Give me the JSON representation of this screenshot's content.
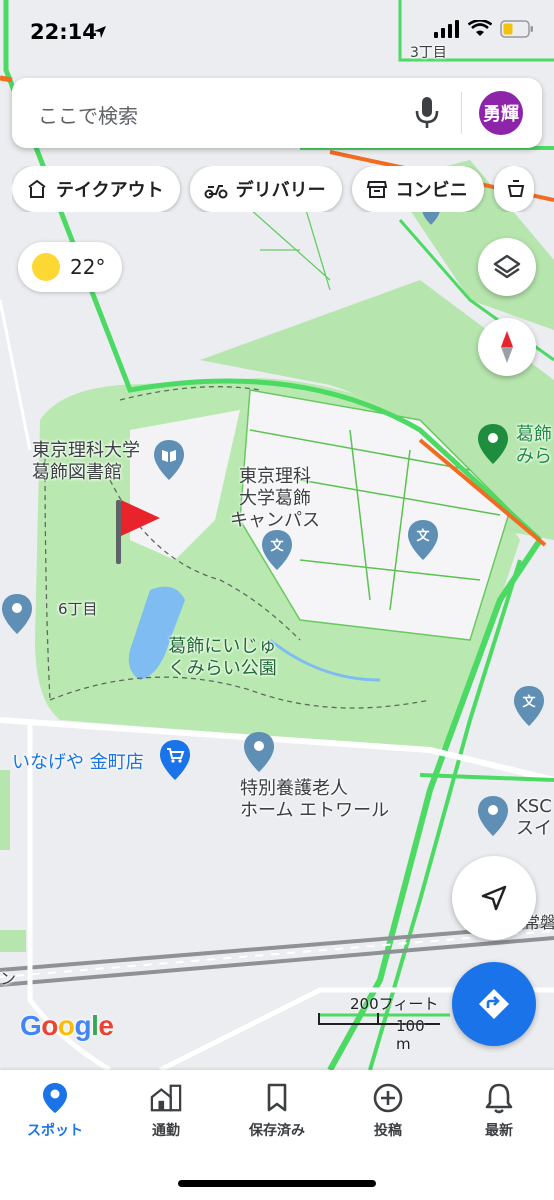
{
  "status_bar": {
    "time": "22:14"
  },
  "search": {
    "placeholder": "ここで検索",
    "avatar_text": "勇輝"
  },
  "chips": [
    {
      "label": "テイクアウト",
      "icon": "takeout-icon"
    },
    {
      "label": "デリバリー",
      "icon": "delivery-scooter-icon"
    },
    {
      "label": "コンビニ",
      "icon": "store-icon"
    }
  ],
  "weather": {
    "temperature": "22°",
    "icon": "sun-icon"
  },
  "map_labels": {
    "district_3": "3丁目",
    "library": "東京理科大学\n葛飾図書館",
    "campus": "東京理科\n大学葛飾\nキャンパス",
    "district_6": "6丁目",
    "park": "葛飾にいじゅ\nくみらい公園",
    "inageya": "いなげや 金町店",
    "nursing_home": "特別養護老人\nホーム エトワール",
    "ksc": "KSC\nスイ",
    "katsushika_right": "葛飾\nみら",
    "joban": "常磐",
    "left_edge": "ン"
  },
  "scale": {
    "imperial": "200フィート",
    "metric": "100 m"
  },
  "logo": "Google",
  "colors": {
    "accent": "#1a73e8",
    "park": "#a8e6a1",
    "route": "#4cd964",
    "traffic": "#f26b21",
    "avatar": "#8e24aa",
    "flag": "#e8232b"
  },
  "bottom_nav": [
    {
      "label": "スポット",
      "icon": "place-pin-icon",
      "active": true
    },
    {
      "label": "通勤",
      "icon": "commute-building-icon",
      "active": false
    },
    {
      "label": "保存済み",
      "icon": "bookmark-icon",
      "active": false
    },
    {
      "label": "投稿",
      "icon": "add-circle-icon",
      "active": false
    },
    {
      "label": "最新",
      "icon": "bell-icon",
      "active": false
    }
  ]
}
